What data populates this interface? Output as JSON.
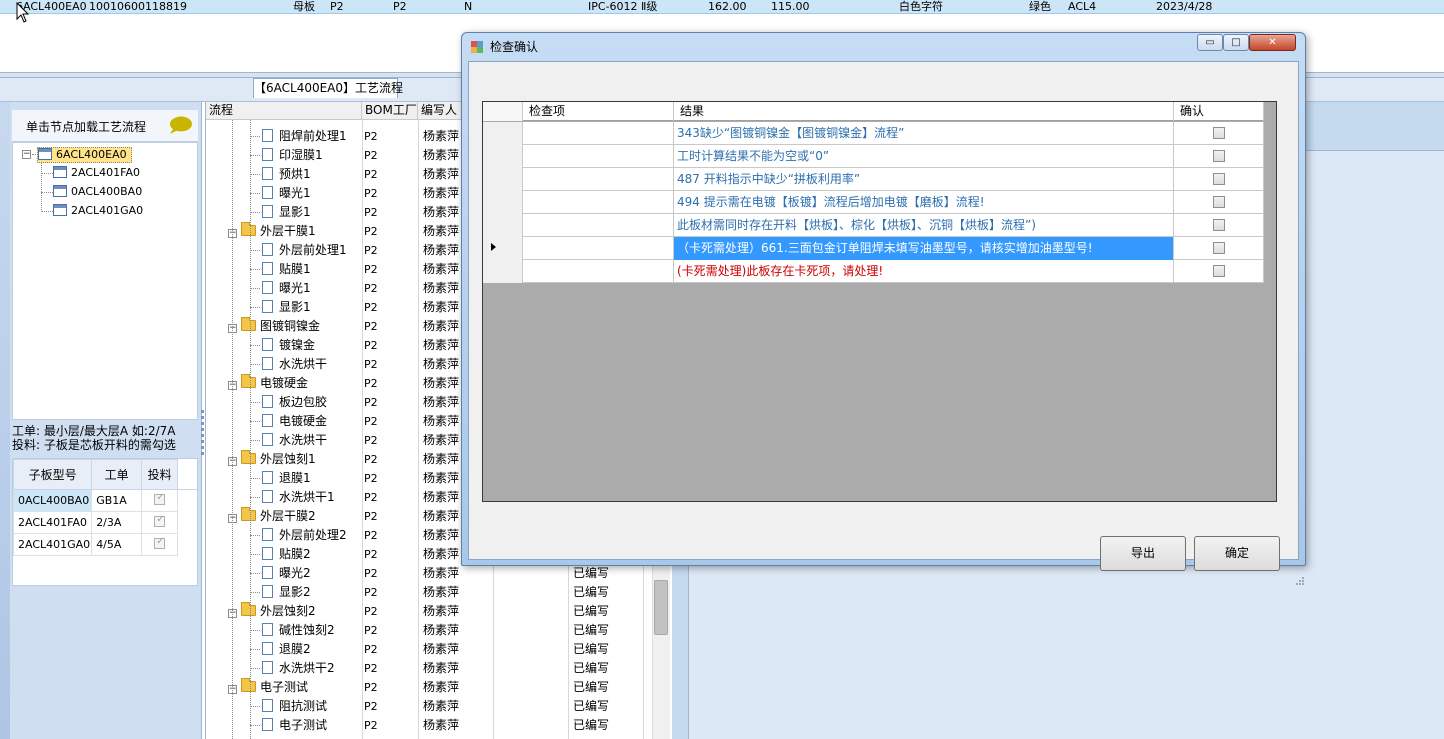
{
  "top_grid": {
    "row": [
      "6ACL400EA0",
      "10010600118819",
      "母板",
      "P2",
      "P2",
      "N",
      "IPC-6012 Ⅱ级",
      "162.00",
      "115.00",
      "白色字符",
      "绿色",
      "ACL4",
      "2023/4/28"
    ]
  },
  "process_tab": {
    "label": "【6ACL400EA0】工艺流程"
  },
  "left_panel": {
    "tree_header": "单击节点加载工艺流程",
    "tree": {
      "root": "6ACL400EA0",
      "children": [
        "2ACL401FA0",
        "0ACL400BA0",
        "2ACL401GA0"
      ]
    },
    "hint_line1": "工单: 最小层/最大层A 如:2/7A",
    "hint_line2": "投料: 子板是芯板开料的需勾选",
    "sub_grid": {
      "headers": [
        "子板型号",
        "工单",
        "投料"
      ],
      "rows": [
        {
          "model": "0ACL400BA0",
          "order": "GB1A"
        },
        {
          "model": "2ACL401FA0",
          "order": "2/3A"
        },
        {
          "model": "2ACL401GA0",
          "order": "4/5A"
        }
      ]
    }
  },
  "process_grid": {
    "headers": [
      "流程",
      "BOM工厂",
      "编写人"
    ],
    "rows": [
      {
        "name": "阻焊前处理1",
        "bom": "P2",
        "author": "杨素萍",
        "status": "",
        "folder": false
      },
      {
        "name": "印湿膜1",
        "bom": "P2",
        "author": "杨素萍",
        "status": "",
        "folder": false
      },
      {
        "name": "预烘1",
        "bom": "P2",
        "author": "杨素萍",
        "status": "",
        "folder": false
      },
      {
        "name": "曝光1",
        "bom": "P2",
        "author": "杨素萍",
        "status": "",
        "folder": false
      },
      {
        "name": "显影1",
        "bom": "P2",
        "author": "杨素萍",
        "status": "",
        "folder": false
      },
      {
        "name": "外层干膜1",
        "bom": "P2",
        "author": "杨素萍",
        "status": "",
        "folder": true
      },
      {
        "name": "外层前处理1",
        "bom": "P2",
        "author": "杨素萍",
        "status": "",
        "folder": false
      },
      {
        "name": "贴膜1",
        "bom": "P2",
        "author": "杨素萍",
        "status": "",
        "folder": false
      },
      {
        "name": "曝光1",
        "bom": "P2",
        "author": "杨素萍",
        "status": "",
        "folder": false
      },
      {
        "name": "显影1",
        "bom": "P2",
        "author": "杨素萍",
        "status": "",
        "folder": false
      },
      {
        "name": "图镀铜镍金",
        "bom": "P2",
        "author": "杨素萍",
        "status": "",
        "folder": true
      },
      {
        "name": "镀镍金",
        "bom": "P2",
        "author": "杨素萍",
        "status": "",
        "folder": false
      },
      {
        "name": "水洗烘干",
        "bom": "P2",
        "author": "杨素萍",
        "status": "",
        "folder": false
      },
      {
        "name": "电镀硬金",
        "bom": "P2",
        "author": "杨素萍",
        "status": "",
        "folder": true
      },
      {
        "name": "板边包胶",
        "bom": "P2",
        "author": "杨素萍",
        "status": "",
        "folder": false
      },
      {
        "name": "电镀硬金",
        "bom": "P2",
        "author": "杨素萍",
        "status": "",
        "folder": false
      },
      {
        "name": "水洗烘干",
        "bom": "P2",
        "author": "杨素萍",
        "status": "",
        "folder": false
      },
      {
        "name": "外层蚀刻1",
        "bom": "P2",
        "author": "杨素萍",
        "status": "",
        "folder": true
      },
      {
        "name": "退膜1",
        "bom": "P2",
        "author": "杨素萍",
        "status": "",
        "folder": false
      },
      {
        "name": "水洗烘干1",
        "bom": "P2",
        "author": "杨素萍",
        "status": "",
        "folder": false
      },
      {
        "name": "外层干膜2",
        "bom": "P2",
        "author": "杨素萍",
        "status": "",
        "folder": true
      },
      {
        "name": "外层前处理2",
        "bom": "P2",
        "author": "杨素萍",
        "status": "",
        "folder": false
      },
      {
        "name": "贴膜2",
        "bom": "P2",
        "author": "杨素萍",
        "status": "",
        "folder": false
      },
      {
        "name": "曝光2",
        "bom": "P2",
        "author": "杨素萍",
        "status": "已编写",
        "folder": false
      },
      {
        "name": "显影2",
        "bom": "P2",
        "author": "杨素萍",
        "status": "已编写",
        "folder": false
      },
      {
        "name": "外层蚀刻2",
        "bom": "P2",
        "author": "杨素萍",
        "status": "已编写",
        "folder": true
      },
      {
        "name": "碱性蚀刻2",
        "bom": "P2",
        "author": "杨素萍",
        "status": "已编写",
        "folder": false
      },
      {
        "name": "退膜2",
        "bom": "P2",
        "author": "杨素萍",
        "status": "已编写",
        "folder": false
      },
      {
        "name": "水洗烘干2",
        "bom": "P2",
        "author": "杨素萍",
        "status": "已编写",
        "folder": false
      },
      {
        "name": "电子测试",
        "bom": "P2",
        "author": "杨素萍",
        "status": "已编写",
        "folder": true
      },
      {
        "name": "阻抗测试",
        "bom": "P2",
        "author": "杨素萍",
        "status": "已编写",
        "folder": false
      },
      {
        "name": "电子测试",
        "bom": "P2",
        "author": "杨素萍",
        "status": "已编写",
        "folder": false
      }
    ]
  },
  "dialog": {
    "title": "检查确认",
    "controls": {
      "minimize": "▭",
      "maximize": "□",
      "close": "✕"
    },
    "grid": {
      "headers": [
        "检查项",
        "结果",
        "确认"
      ],
      "rows": [
        {
          "result": "343缺少“图镀铜镍金【图镀铜镍金】流程”",
          "style": "normal"
        },
        {
          "result": "工时计算结果不能为空或“0”",
          "style": "normal"
        },
        {
          "result": "487 开料指示中缺少“拼板利用率”",
          "style": "normal"
        },
        {
          "result": "494 提示需在电镀【板镀】流程后增加电镀【磨板】流程!",
          "style": "normal"
        },
        {
          "result": "此板材需同时存在开料【烘板】、棕化【烘板】、沉铜【烘板】流程”)",
          "style": "normal"
        },
        {
          "result": "（卡死需处理）661.三面包金订单阻焊未填写油墨型号，请核实增加油墨型号!",
          "style": "selected"
        },
        {
          "result": "(卡死需处理)此板存在卡死项，请处理!",
          "style": "danger"
        }
      ]
    },
    "buttons": {
      "export": "导出",
      "ok": "确定"
    }
  }
}
